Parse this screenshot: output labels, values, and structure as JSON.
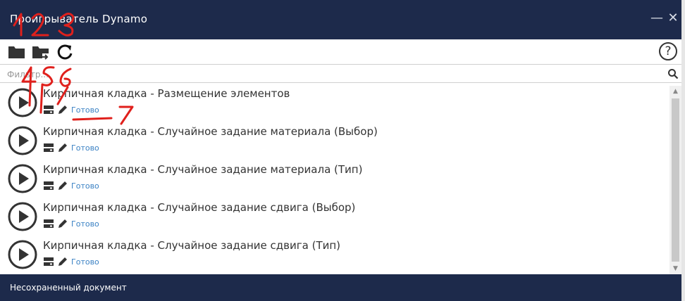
{
  "window": {
    "title": "Проигрыватель Dynamo",
    "minimize_label": "—",
    "close_label": "✕"
  },
  "toolbar": {
    "help_label": "?"
  },
  "filter": {
    "placeholder": "Фильтр..."
  },
  "graphs": [
    {
      "name": "Кирпичная кладка - Размещение элементов",
      "status": "Готово"
    },
    {
      "name": "Кирпичная кладка - Случайное задание материала (Выбор)",
      "status": "Готово"
    },
    {
      "name": "Кирпичная кладка - Случайное задание материала (Тип)",
      "status": "Готово"
    },
    {
      "name": "Кирпичная кладка - Случайное задание сдвига (Выбор)",
      "status": "Готово"
    },
    {
      "name": "Кирпичная кладка - Случайное задание сдвига (Тип)",
      "status": "Готово"
    }
  ],
  "statusbar": {
    "text": "Несохраненный документ"
  },
  "annotations": {
    "labels": [
      "1",
      "2",
      "3",
      "4",
      "5",
      "6",
      "7"
    ],
    "color": "#e0201c"
  },
  "colors": {
    "titlebar": "#1d2a4b",
    "status_link": "#3b82c4"
  },
  "icons": {
    "open_folder": "folder-icon",
    "open_folder_move": "folder-arrow-icon",
    "refresh": "refresh-icon",
    "help": "help-icon",
    "search": "search-icon",
    "play": "play-icon",
    "inputs": "inputs-icon",
    "edit": "pencil-icon"
  }
}
